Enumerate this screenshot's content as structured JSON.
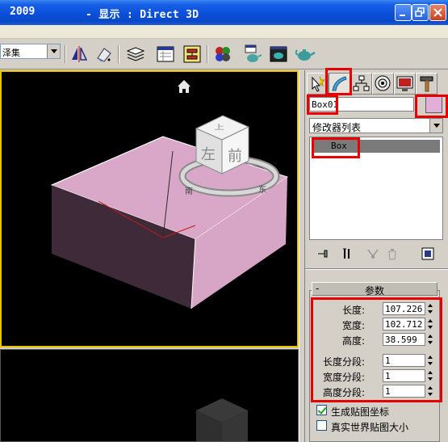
{
  "titlebar": {
    "version": "2009",
    "text": "- 显示 : Direct 3D"
  },
  "toolbar": {
    "selection_set_value": "泽集"
  },
  "viewport": {
    "viewcube": {
      "face_top": "上",
      "face_left": "左",
      "face_front": "前",
      "compass_s": "南",
      "compass_e": "东"
    },
    "box_color": "#d9a8c9"
  },
  "command_panel": {
    "object_name": "Box01",
    "object_color": "#e3aed8",
    "modifier_list_label": "修改器列表",
    "stack_items": [
      "Box"
    ],
    "parameters": {
      "rollout_title": "参数",
      "collapse_symbol": "-",
      "length_label": "长度:",
      "length_value": "107.226",
      "width_label": "宽度:",
      "width_value": "102.712",
      "height_label": "高度:",
      "height_value": "38.599",
      "length_segs_label": "长度分段:",
      "length_segs_value": "1",
      "width_segs_label": "宽度分段:",
      "width_segs_value": "1",
      "height_segs_label": "高度分段:",
      "height_segs_value": "1",
      "gen_mapping_label": "生成贴图坐标",
      "gen_mapping_checked": true,
      "real_world_label": "真实世界贴图大小",
      "real_world_checked": false
    }
  },
  "colors": {
    "highlight": "#e80000",
    "titlebar": "#0b4fd8",
    "active_viewport_border": "#e6c400"
  }
}
